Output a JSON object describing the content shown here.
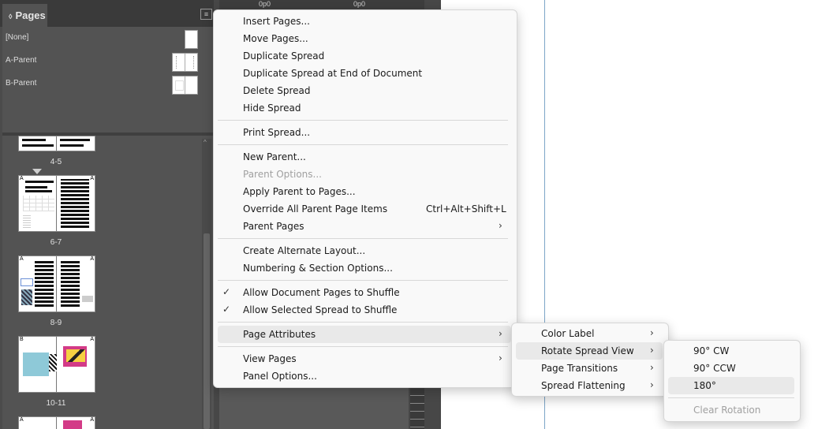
{
  "panel": {
    "tab_label": "Pages",
    "tab_glyph": "◊",
    "parents": [
      {
        "label": "[None]"
      },
      {
        "label": "A-Parent"
      },
      {
        "label": "B-Parent"
      }
    ],
    "spreads": [
      {
        "label": "4-5",
        "left_prefix": "",
        "right_prefix": ""
      },
      {
        "label": "6-7",
        "left_prefix": "A",
        "right_prefix": "A"
      },
      {
        "label": "8-9",
        "left_prefix": "A",
        "right_prefix": "A"
      },
      {
        "label": "10-11",
        "left_prefix": "B",
        "right_prefix": "A"
      },
      {
        "label": "",
        "left_prefix": "A",
        "right_prefix": "A"
      }
    ]
  },
  "ruler": {
    "value_1": "0p0",
    "value_2": "0p0"
  },
  "context_menu": {
    "items": [
      {
        "label": "Insert Pages...",
        "enabled": true
      },
      {
        "label": "Move Pages...",
        "enabled": true
      },
      {
        "label": "Duplicate Spread",
        "enabled": true
      },
      {
        "label": "Duplicate Spread at End of Document",
        "enabled": true
      },
      {
        "label": "Delete Spread",
        "enabled": true
      },
      {
        "label": "Hide Spread",
        "enabled": true
      },
      {
        "label": "Print Spread...",
        "enabled": true
      },
      {
        "label": "New Parent...",
        "enabled": true
      },
      {
        "label": "Parent Options...",
        "enabled": false
      },
      {
        "label": "Apply Parent to Pages...",
        "enabled": true
      },
      {
        "label": "Override All Parent Page Items",
        "enabled": true,
        "shortcut": "Ctrl+Alt+Shift+L"
      },
      {
        "label": "Parent Pages",
        "enabled": true,
        "submenu": true
      },
      {
        "label": "Create Alternate Layout...",
        "enabled": true
      },
      {
        "label": "Numbering & Section Options...",
        "enabled": true
      },
      {
        "label": "Allow Document Pages to Shuffle",
        "enabled": true,
        "checked": true
      },
      {
        "label": "Allow Selected Spread to Shuffle",
        "enabled": true,
        "checked": true
      },
      {
        "label": "Page Attributes",
        "enabled": true,
        "submenu": true,
        "highlighted": true
      },
      {
        "label": "View Pages",
        "enabled": true,
        "submenu": true
      },
      {
        "label": "Panel Options...",
        "enabled": true
      }
    ]
  },
  "page_attributes_menu": {
    "items": [
      {
        "label": "Color Label"
      },
      {
        "label": "Rotate Spread View",
        "highlighted": true
      },
      {
        "label": "Page Transitions"
      },
      {
        "label": "Spread Flattening"
      }
    ]
  },
  "rotate_menu": {
    "items": [
      {
        "label": "90° CW",
        "enabled": true
      },
      {
        "label": "90° CCW",
        "enabled": true
      },
      {
        "label": "180°",
        "enabled": true,
        "highlighted": true
      },
      {
        "label": "Clear Rotation",
        "enabled": false
      }
    ]
  },
  "glyphs": {
    "check": "✓",
    "arrow": "›",
    "menu": "≡",
    "scroll_up": "^"
  }
}
